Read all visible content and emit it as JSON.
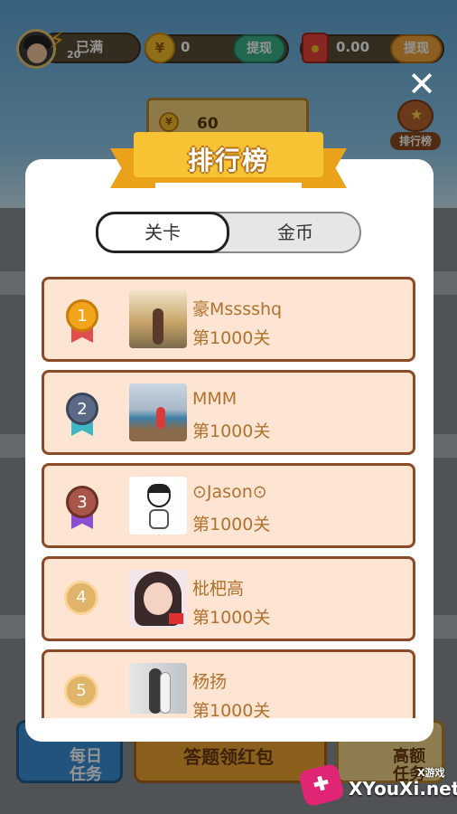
{
  "topbar": {
    "energy_level": "20",
    "energy_text": "已满",
    "coin_symbol": "¥",
    "coin_value": "0",
    "withdraw_label": "提现",
    "cash_value": "0.00",
    "withdraw_label_2": "提现"
  },
  "score": {
    "symbol": "¥",
    "value": "60"
  },
  "rank_button": {
    "label": "排行榜"
  },
  "modal": {
    "title": "排行榜",
    "tabs": [
      {
        "label": "关卡",
        "active": true
      },
      {
        "label": "金币",
        "active": false
      }
    ],
    "rows": [
      {
        "rank": "1",
        "name": "豪Msssshq",
        "level": "第1000关"
      },
      {
        "rank": "2",
        "name": "MMM",
        "level": "第1000关"
      },
      {
        "rank": "3",
        "name": "⊙Jason⊙",
        "level": "第1000关"
      },
      {
        "rank": "4",
        "name": "枇杷高",
        "level": "第1000关"
      },
      {
        "rank": "5",
        "name": "杨扬",
        "level": "第1000关"
      }
    ]
  },
  "bottom": {
    "daily_task": "每日\n任务",
    "answer_redpack": "答题领红包",
    "high_task": "高额\n任务"
  },
  "watermark": {
    "small": "X游戏",
    "big": "XYouXi.net"
  },
  "colors": {
    "accent_gold": "#f8c235",
    "row_bg": "#fde4d3",
    "row_border": "#8b4a28",
    "text_brown": "#b0722e",
    "withdraw_green": "#3bb28b",
    "withdraw_orange": "#f0a43a"
  }
}
